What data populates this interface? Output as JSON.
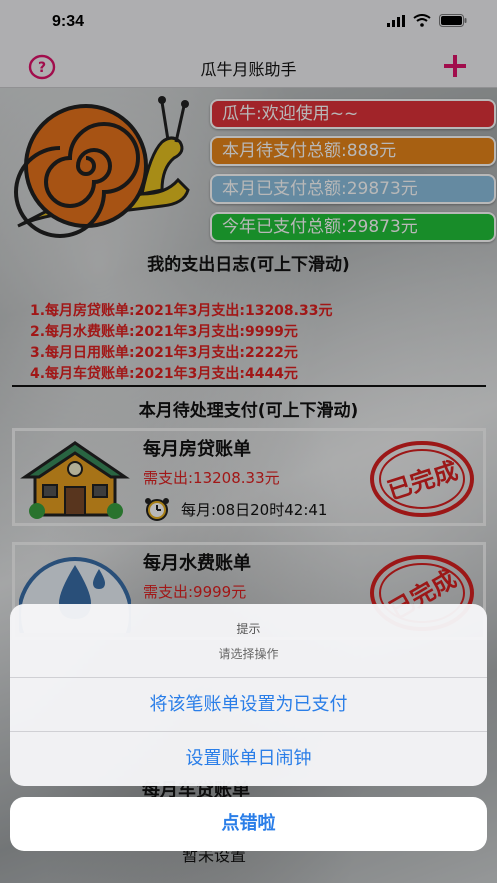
{
  "status": {
    "time": "9:34"
  },
  "nav": {
    "title": "瓜牛月账助手",
    "help_icon": "help-icon",
    "add_icon": "plus-icon"
  },
  "colors": {
    "pill_red": "#e0323a",
    "pill_orange": "#e8861a",
    "pill_blue": "#8cc0e0",
    "pill_green": "#22c23a",
    "accent": "#e0126a",
    "action_blue": "#2a7ee8"
  },
  "banners": {
    "welcome": "瓜牛:欢迎使用~~",
    "pending_month": "本月待支付总额:888元",
    "paid_month": "本月已支付总额:29873元",
    "paid_year": "今年已支付总额:29873元"
  },
  "log": {
    "title": "我的支出日志(可上下滑动)",
    "lines": [
      "1.每月房贷账单:2021年3月支出:13208.33元",
      "2.每月水费账单:2021年3月支出:9999元",
      "3.每月日用账单:2021年3月支出:2222元",
      "4.每月车贷账单:2021年3月支出:4444元"
    ]
  },
  "pending": {
    "title": "本月待处理支付(可上下滑动)",
    "cards": [
      {
        "title": "每月房贷账单",
        "amount": "需支出:13208.33元",
        "schedule": "每月:08日20时42:41",
        "stamp": "已完成"
      },
      {
        "title": "每月水费账单",
        "amount": "需支出:9999元",
        "stamp": "已完成"
      }
    ],
    "peek_title": "每月车贷账单",
    "peek_text": "暂未设置"
  },
  "sheet": {
    "title": "提示",
    "message": "请选择操作",
    "actions": [
      "将该笔账单设置为已支付",
      "设置账单日闹钟"
    ],
    "cancel": "点错啦"
  }
}
